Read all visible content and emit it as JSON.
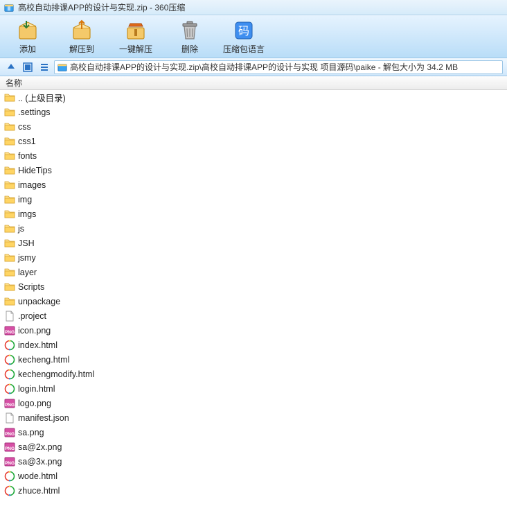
{
  "title": "高校自动排课APP的设计与实现.zip - 360压缩",
  "toolbar": {
    "add": "添加",
    "extract_to": "解压到",
    "one_click_extract": "一键解压",
    "delete": "删除",
    "lang": "压缩包语言"
  },
  "addressbar": {
    "path": "高校自动排课APP的设计与实现.zip\\高校自动排课APP的设计与实现 项目源码\\paike - 解包大小为 34.2 MB"
  },
  "columns": {
    "name": "名称"
  },
  "files": [
    {
      "name": ".. (上级目录)",
      "icon": "folder"
    },
    {
      "name": ".settings",
      "icon": "folder"
    },
    {
      "name": "css",
      "icon": "folder"
    },
    {
      "name": "css1",
      "icon": "folder"
    },
    {
      "name": "fonts",
      "icon": "folder"
    },
    {
      "name": "HideTips",
      "icon": "folder"
    },
    {
      "name": "images",
      "icon": "folder"
    },
    {
      "name": "img",
      "icon": "folder"
    },
    {
      "name": "imgs",
      "icon": "folder"
    },
    {
      "name": "js",
      "icon": "folder"
    },
    {
      "name": "JSH",
      "icon": "folder"
    },
    {
      "name": "jsmy",
      "icon": "folder"
    },
    {
      "name": "layer",
      "icon": "folder"
    },
    {
      "name": "Scripts",
      "icon": "folder"
    },
    {
      "name": "unpackage",
      "icon": "folder"
    },
    {
      "name": ".project",
      "icon": "file"
    },
    {
      "name": "icon.png",
      "icon": "png"
    },
    {
      "name": "index.html",
      "icon": "html"
    },
    {
      "name": "kecheng.html",
      "icon": "html"
    },
    {
      "name": "kechengmodify.html",
      "icon": "html"
    },
    {
      "name": "login.html",
      "icon": "html"
    },
    {
      "name": "logo.png",
      "icon": "png"
    },
    {
      "name": "manifest.json",
      "icon": "file"
    },
    {
      "name": "sa.png",
      "icon": "png"
    },
    {
      "name": "sa@2x.png",
      "icon": "png"
    },
    {
      "name": "sa@3x.png",
      "icon": "png"
    },
    {
      "name": "wode.html",
      "icon": "html"
    },
    {
      "name": "zhuce.html",
      "icon": "html"
    }
  ]
}
